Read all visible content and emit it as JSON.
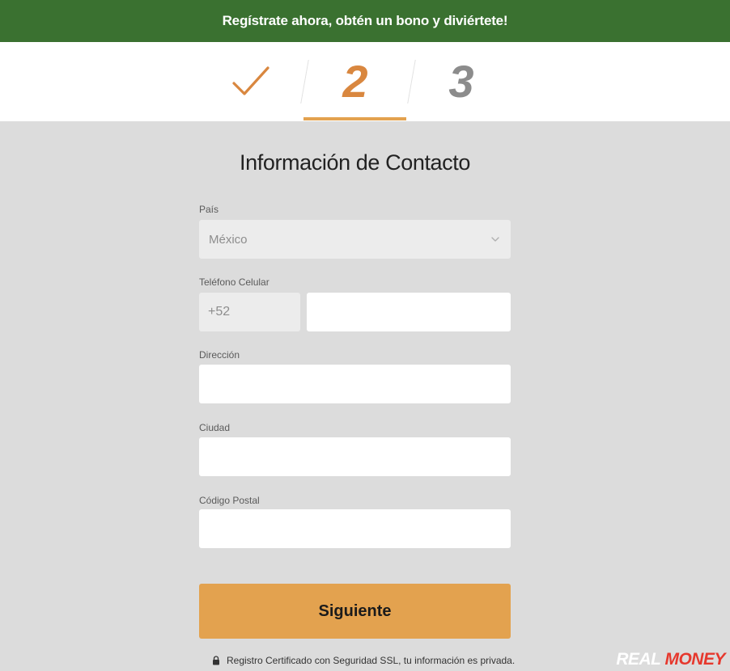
{
  "banner": {
    "text": "Regístrate ahora, obtén un bono y diviértete!",
    "color": "#3a7130"
  },
  "steps": {
    "current": "2",
    "next": "3",
    "completed_icon": "check-icon",
    "accent_color": "#d9873f",
    "inactive_color": "#8c8c8c"
  },
  "form": {
    "title": "Información de Contacto",
    "country": {
      "label": "País",
      "value": "México",
      "icon": "chevron-down-icon"
    },
    "phone": {
      "label": "Teléfono Celular",
      "prefix": "+52",
      "value": ""
    },
    "address": {
      "label": "Dirección",
      "value": ""
    },
    "city": {
      "label": "Ciudad",
      "value": ""
    },
    "postal_code": {
      "label": "Código Postal",
      "value": ""
    },
    "submit_label": "Siguiente",
    "submit_color": "#e3a24f"
  },
  "footer": {
    "ssl_note": "Registro Certificado con Seguridad SSL, tu información es privada.",
    "lock_icon": "lock-icon"
  },
  "watermark": {
    "part1": "REAL",
    "part2": "MONEY",
    "part2_color": "#e6382d"
  }
}
